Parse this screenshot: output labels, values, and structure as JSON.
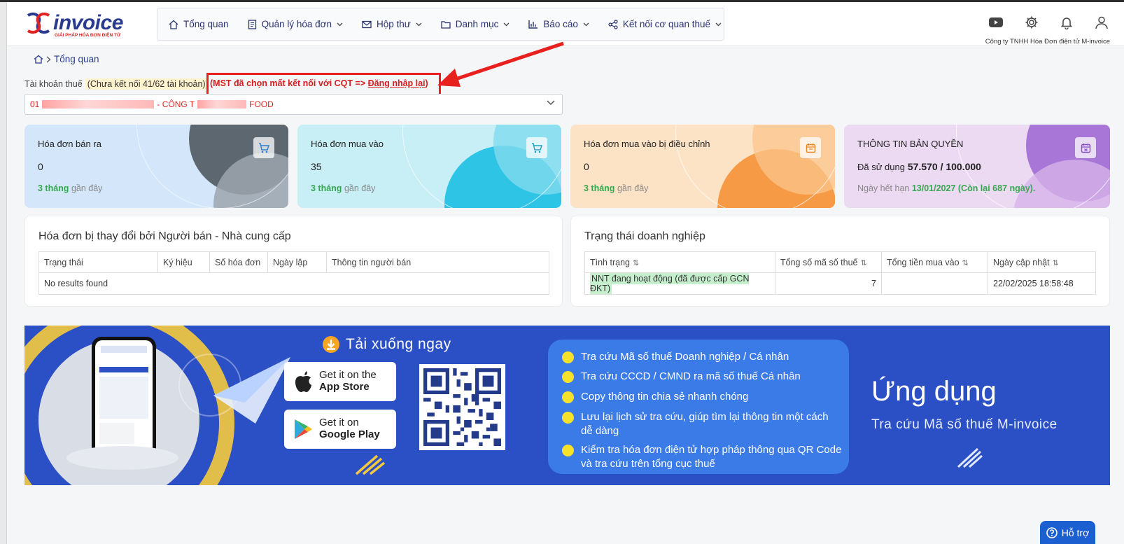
{
  "logo": {
    "word": "invoice",
    "tagline": "GIẢI PHÁP HÓA ĐƠN ĐIỆN TỬ"
  },
  "nav": [
    {
      "label": "Tổng quan",
      "icon": "home-icon",
      "dropdown": false
    },
    {
      "label": "Quản lý hóa đơn",
      "icon": "document-icon",
      "dropdown": true
    },
    {
      "label": "Hộp thư",
      "icon": "mail-icon",
      "dropdown": true
    },
    {
      "label": "Danh mục",
      "icon": "folder-icon",
      "dropdown": true
    },
    {
      "label": "Báo cáo",
      "icon": "chart-icon",
      "dropdown": true
    },
    {
      "label": "Kết nối cơ quan thuế",
      "icon": "share-icon",
      "dropdown": true
    }
  ],
  "header": {
    "company": "Công ty TNHH Hóa Đơn điện tử M-invoice"
  },
  "breadcrumb": {
    "current": "Tổng quan"
  },
  "tax": {
    "label": "Tài khoản thuế",
    "status": "(Chưa kết nối 41/62 tài khoản)",
    "warning_prefix": "(MST đã chọn mất kết nối với CQT => ",
    "warning_link": "Đăng nhập lại",
    "warning_suffix": ")",
    "selected_prefix": "01",
    "selected_mid": "- CÔNG T",
    "selected_suffix": "FOOD"
  },
  "cards": [
    {
      "title": "Hóa đơn bán ra",
      "value": "0",
      "sub_bold": "3 tháng",
      "sub_rest": "gần đây",
      "icon": "cart-icon"
    },
    {
      "title": "Hóa đơn mua vào",
      "value": "35",
      "sub_bold": "3 tháng",
      "sub_rest": "gần đây",
      "icon": "cart-icon"
    },
    {
      "title": "Hóa đơn mua vào bị điều chỉnh",
      "value": "0",
      "sub_bold": "3 tháng",
      "sub_rest": "gần đây",
      "icon": "calendar-icon"
    },
    {
      "title": "THÔNG TIN BẢN QUYỀN",
      "value_prefix": "Đã sử dụng",
      "value_bold": "57.570 / 100.000",
      "sub_prefix": "Ngày hết hạn",
      "sub_highlight": "13/01/2027 (Còn lại 687 ngày).",
      "icon": "calendar-icon"
    }
  ],
  "changed_panel": {
    "title": "Hóa đơn bị thay đổi bởi Người bán - Nhà cung cấp",
    "columns": [
      "Trạng thái",
      "Ký hiệu",
      "Số hóa đơn",
      "Ngày lập",
      "Thông tin người bán"
    ],
    "empty": "No results found"
  },
  "status_panel": {
    "title": "Trạng thái doanh nghiệp",
    "columns": [
      "Tình trạng",
      "Tổng số mã số thuế",
      "Tổng tiền mua vào",
      "Ngày cập nhật"
    ],
    "rows": [
      {
        "status": "NNT đang hoạt động (đã được cấp GCN ĐKT)",
        "count": "7",
        "amount": "",
        "updated": "22/02/2025 18:58:48"
      }
    ]
  },
  "banner": {
    "download_title": "Tải xuống ngay",
    "appstore_small": "Get it on the",
    "appstore_big": "App Store",
    "googleplay_small": "Get it on",
    "googleplay_big": "Google Play",
    "features": [
      "Tra cứu Mã số thuế Doanh nghiệp / Cá nhân",
      "Tra cứu CCCD / CMND ra mã số thuế Cá nhân",
      "Copy thông tin chia sẻ nhanh chóng",
      "Lưu lại lịch sử tra cứu, giúp tìm lại thông tin một cách dễ dàng",
      "Kiểm tra hóa đơn điện tử hợp pháp thông qua QR Code và tra cứu trên tổng cục thuế"
    ],
    "app_title": "Ứng dụng",
    "app_sub": "Tra cứu Mã số thuế M-invoice"
  },
  "support": {
    "label": "Hỗ trợ"
  },
  "colors": {
    "brand": "#2a3b8f",
    "warning": "#e8201e",
    "banner": "#2b4fc4",
    "green": "#35a84f"
  }
}
